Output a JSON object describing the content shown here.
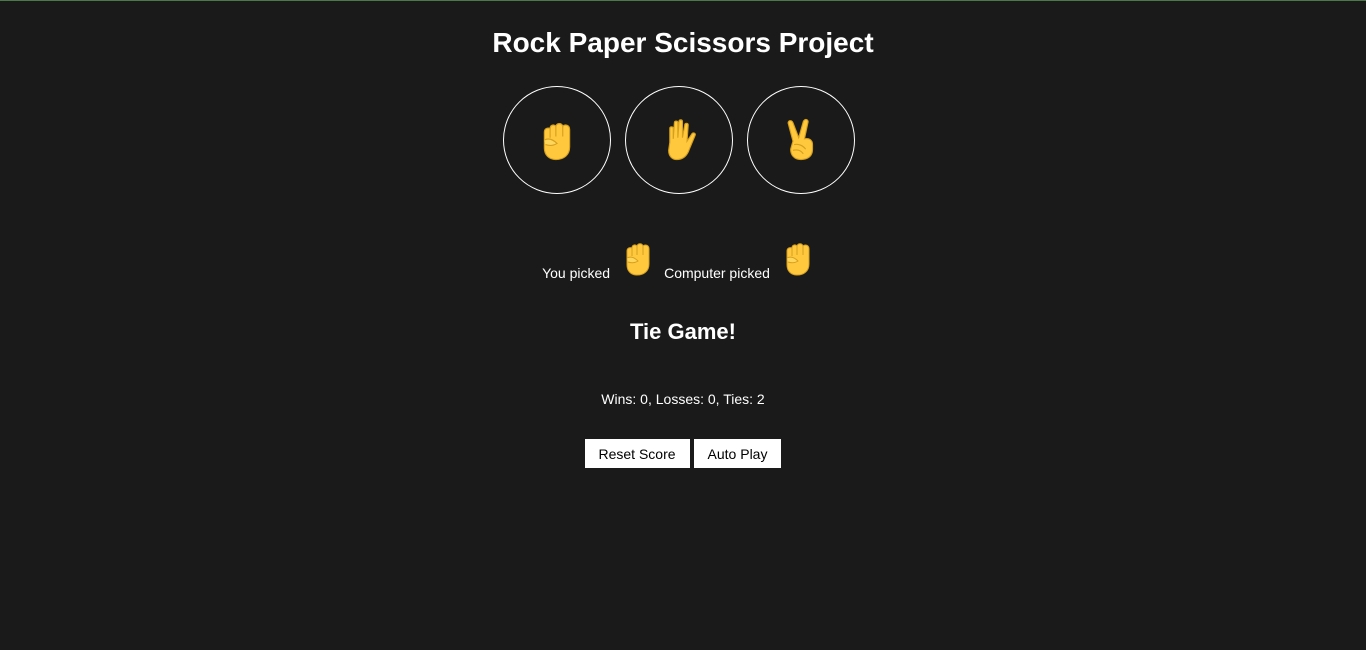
{
  "header": {
    "title": "Rock Paper Scissors Project"
  },
  "moves": [
    {
      "name": "rock",
      "icon": "rock-fist-icon"
    },
    {
      "name": "paper",
      "icon": "paper-hand-icon"
    },
    {
      "name": "scissors",
      "icon": "scissors-peace-icon"
    }
  ],
  "picks": {
    "player_label": "You picked",
    "player_choice": "rock",
    "computer_label": "Computer picked",
    "computer_choice": "rock"
  },
  "result": {
    "text": "Tie Game!"
  },
  "score": {
    "text": "Wins: 0, Losses: 0, Ties: 2"
  },
  "controls": {
    "reset_label": "Reset Score",
    "autoplay_label": "Auto Play"
  },
  "colors": {
    "background": "#1a1a1a",
    "emoji_yellow": "#ffc83d",
    "emoji_outline": "#d6a01e"
  }
}
